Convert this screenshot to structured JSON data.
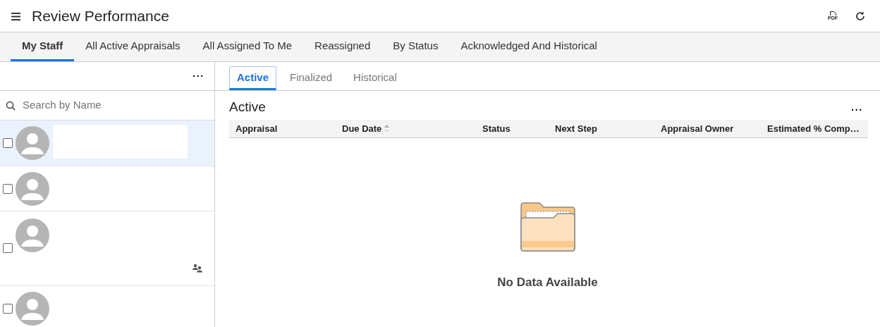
{
  "header": {
    "title": "Review Performance",
    "pdf_label": "PDF"
  },
  "tabs": [
    {
      "label": "My Staff",
      "selected": true
    },
    {
      "label": "All Active Appraisals",
      "selected": false
    },
    {
      "label": "All Assigned To Me",
      "selected": false
    },
    {
      "label": "Reassigned",
      "selected": false
    },
    {
      "label": "By Status",
      "selected": false
    },
    {
      "label": "Acknowledged And Historical",
      "selected": false
    }
  ],
  "staff_panel": {
    "menu": "···",
    "search": {
      "placeholder": "Search by Name"
    },
    "rows": [
      {
        "selected": true,
        "checked": false,
        "name_hidden": true,
        "delegated": false
      },
      {
        "selected": false,
        "checked": false,
        "name_hidden": false,
        "delegated": false
      },
      {
        "selected": false,
        "checked": false,
        "name_hidden": false,
        "delegated": true
      },
      {
        "selected": false,
        "checked": false,
        "name_hidden": false,
        "delegated": false
      }
    ]
  },
  "subtabs": [
    {
      "label": "Active",
      "selected": true
    },
    {
      "label": "Finalized",
      "selected": false
    },
    {
      "label": "Historical",
      "selected": false
    }
  ],
  "section": {
    "title": "Active",
    "menu": "···"
  },
  "table": {
    "columns": [
      {
        "label": "Appraisal",
        "sortable": false
      },
      {
        "label": "Due Date",
        "sortable": true
      },
      {
        "label": "Status",
        "sortable": false
      },
      {
        "label": "Next Step",
        "sortable": false
      },
      {
        "label": "Appraisal Owner",
        "sortable": false
      },
      {
        "label": "Estimated % Comp…",
        "sortable": false
      }
    ],
    "empty_message": "No Data Available"
  }
}
